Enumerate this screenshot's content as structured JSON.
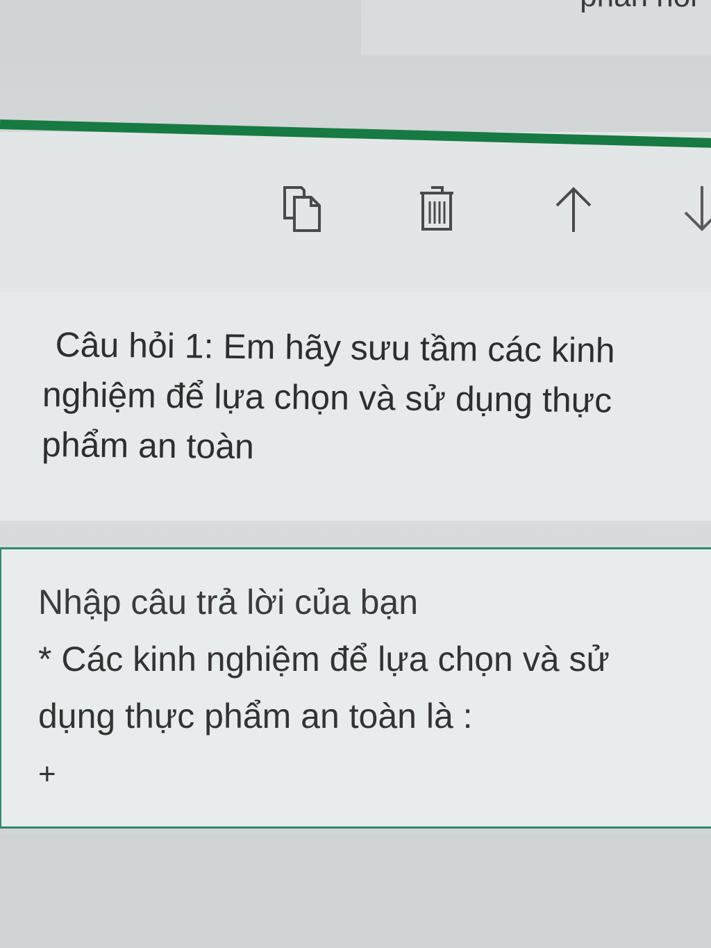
{
  "header": {
    "partial_text": "phản hồi"
  },
  "toolbar": {
    "icons": [
      "copy-icon",
      "delete-icon",
      "arrow-up-icon",
      "arrow-down-icon"
    ]
  },
  "question": {
    "text": "Câu hỏi 1: Em hãy sưu tầm các kinh nghiệm để lựa chọn và sử dụng thực phẩm an toàn"
  },
  "answer": {
    "placeholder": "Nhập câu trả lời của bạn",
    "lines": [
      "* Các kinh nghiệm để lựa chọn và sử",
      "dụng thực phẩm an toàn là :",
      "+"
    ]
  },
  "colors": {
    "accent": "#177a43",
    "border": "#2f8a6a",
    "background": "#d6dada"
  }
}
